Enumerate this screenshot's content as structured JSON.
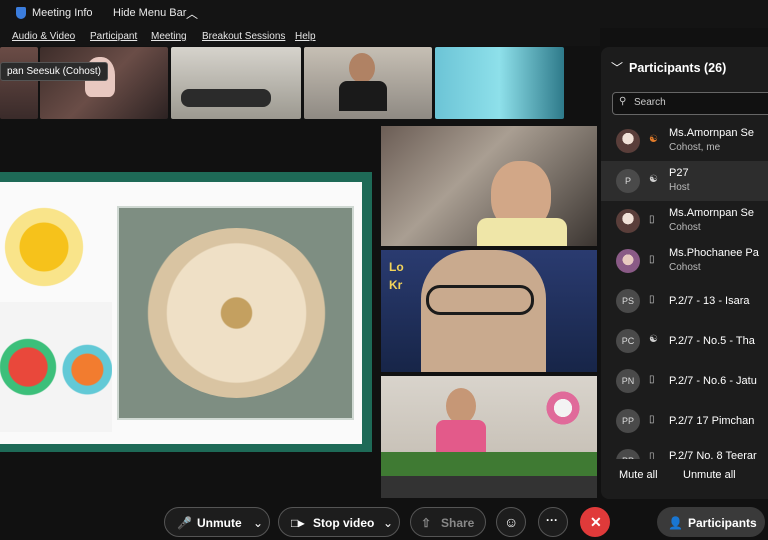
{
  "topbar": {
    "meeting_info": "Meeting Info",
    "hide_menu_bar": "Hide Menu Bar"
  },
  "menubar": {
    "items": [
      "Audio & Video",
      "Participant",
      "Meeting",
      "Breakout Sessions",
      "Help"
    ]
  },
  "thumbnails": {
    "first_name_tag": "pan Seesuk (Cohost)"
  },
  "tile_text": {
    "loy": "Lo",
    "kr": "Kr"
  },
  "panel": {
    "title": "Participants (26)",
    "search_placeholder": "Search",
    "participants": [
      {
        "initials": "",
        "name": "Ms.Amornpan Se",
        "role": "Cohost, me"
      },
      {
        "initials": "P",
        "name": "P27",
        "role": "Host"
      },
      {
        "initials": "",
        "name": "Ms.Amornpan Se",
        "role": "Cohost"
      },
      {
        "initials": "",
        "name": "Ms.Phochanee Pa",
        "role": "Cohost"
      },
      {
        "initials": "PS",
        "name": "P.2/7 - 13 - Isara",
        "role": ""
      },
      {
        "initials": "PC",
        "name": "P.2/7 - No.5 - Tha",
        "role": ""
      },
      {
        "initials": "PN",
        "name": "P.2/7 - No.6 - Jatu",
        "role": ""
      },
      {
        "initials": "PP",
        "name": "P.2/7 17 Pimchan",
        "role": ""
      },
      {
        "initials": "PP",
        "name": "P.2/7 No. 8 Teerar",
        "role": ""
      }
    ],
    "mute_all": "Mute all",
    "unmute_all": "Unmute all"
  },
  "toolbar": {
    "unmute": "Unmute",
    "stop_video": "Stop video",
    "share": "Share",
    "participants": "Participants"
  }
}
